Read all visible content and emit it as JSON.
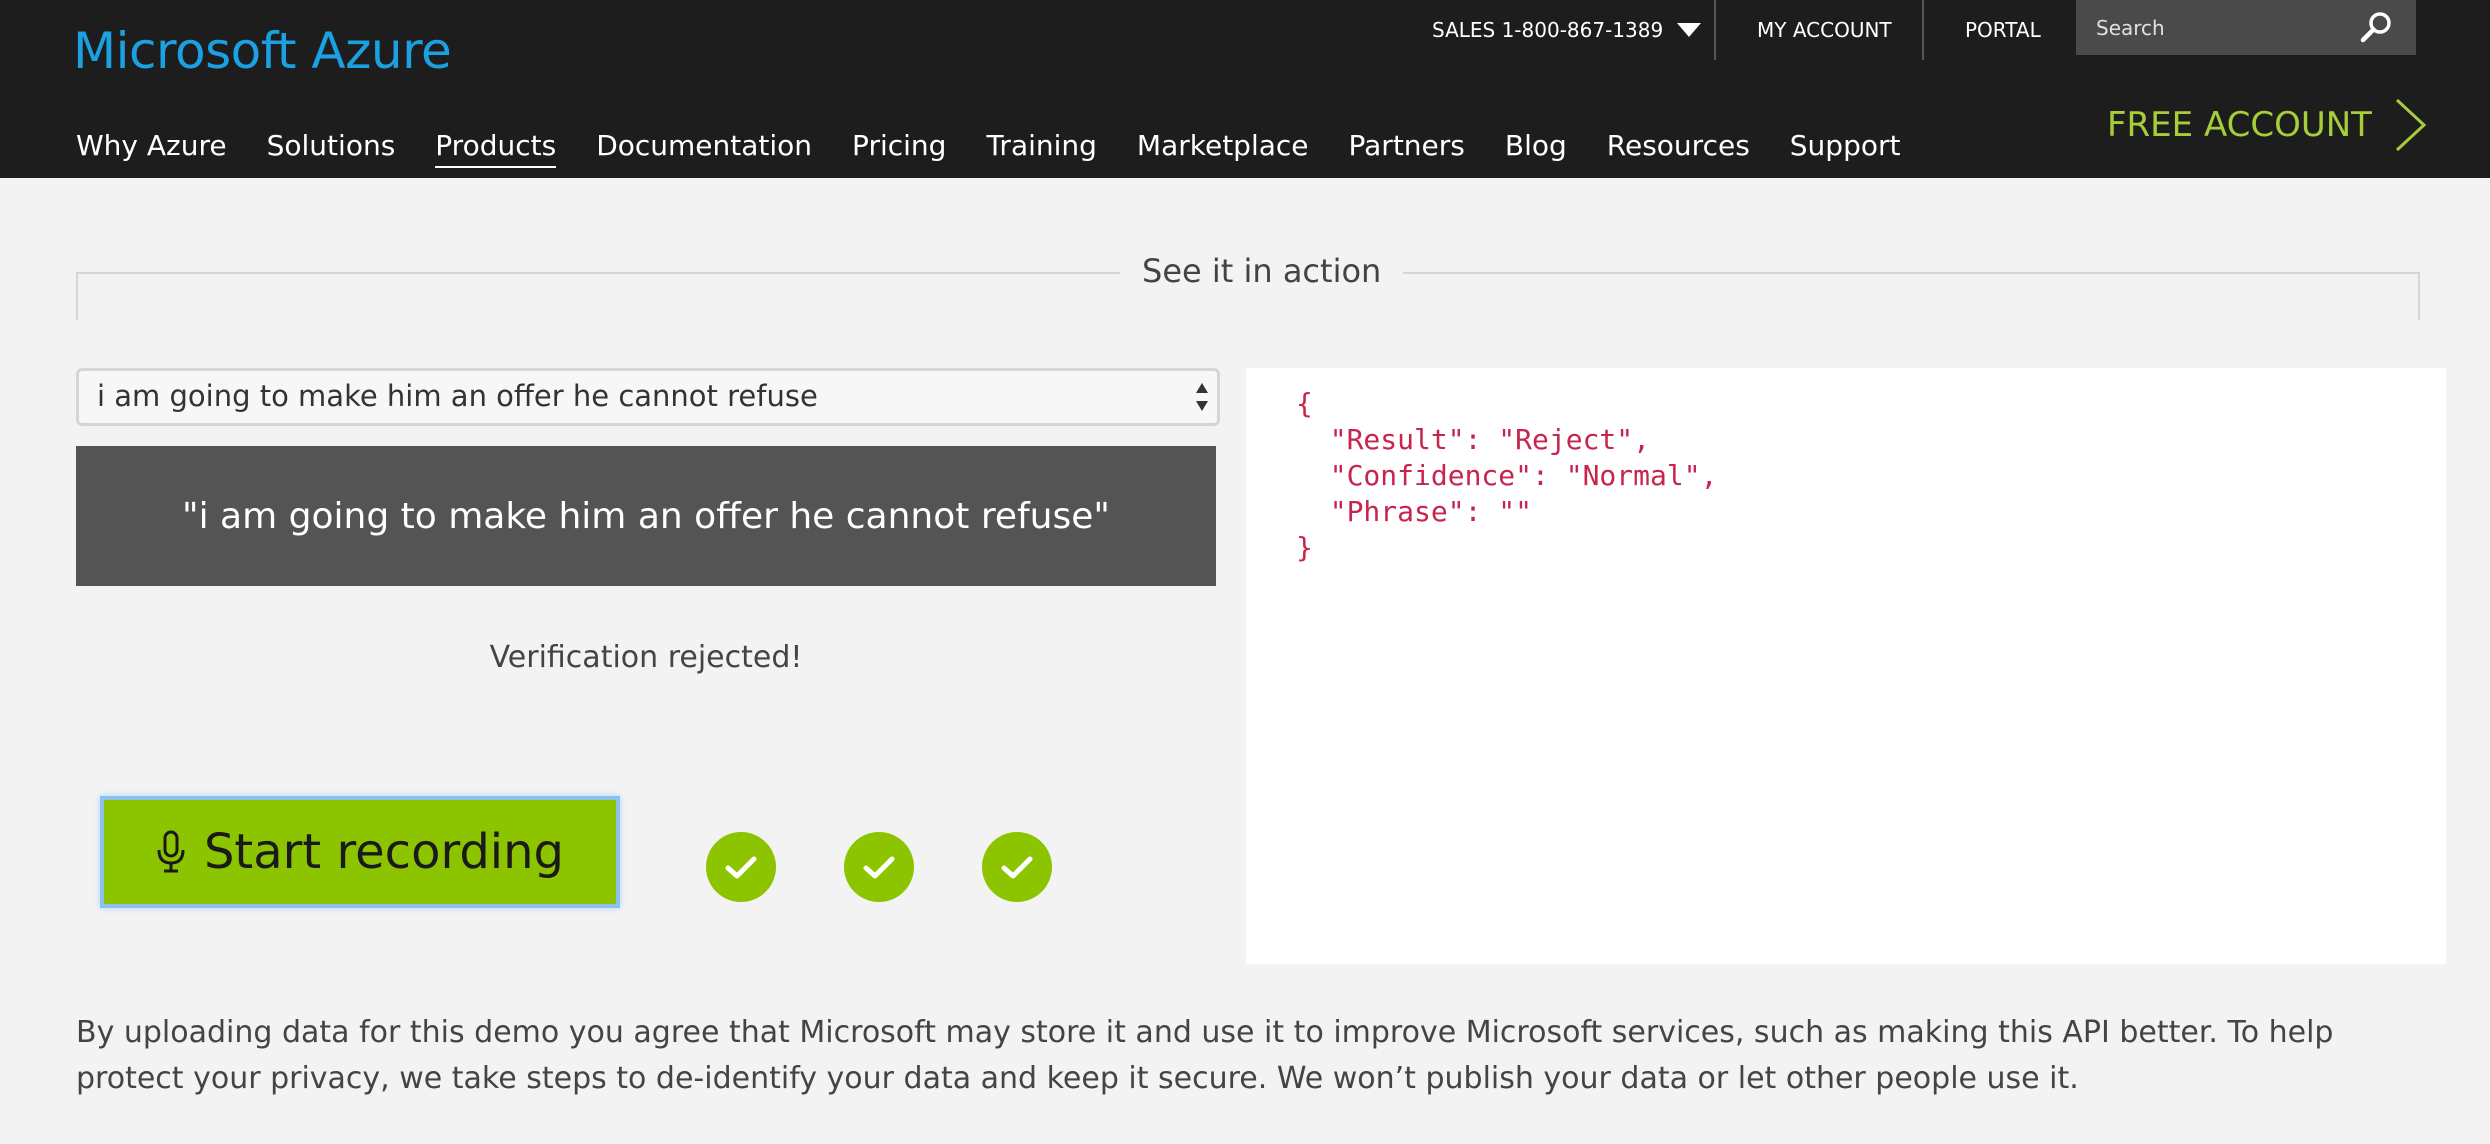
{
  "header": {
    "logo": "Microsoft Azure",
    "sales": "SALES 1-800-867-1389",
    "my_account": "MY ACCOUNT",
    "portal": "PORTAL",
    "search_placeholder": "Search",
    "nav": [
      "Why Azure",
      "Solutions",
      "Products",
      "Documentation",
      "Pricing",
      "Training",
      "Marketplace",
      "Partners",
      "Blog",
      "Resources",
      "Support"
    ],
    "active_nav": "Products",
    "free_account": "FREE ACCOUNT"
  },
  "section": {
    "title": "See it in action"
  },
  "demo": {
    "selected_phrase": "i am going to make him an offer he cannot refuse",
    "phrase_display": "\"i am going to make him an offer he cannot refuse\"",
    "status": "Verification rejected!",
    "record_button": "Start recording",
    "checks_completed": 3
  },
  "result": {
    "json_text": "{\n  \"Result\": \"Reject\",\n  \"Confidence\": \"Normal\",\n  \"Phrase\": \"\"\n}"
  },
  "disclaimer": "By uploading data for this demo you agree that Microsoft may store it and use it to improve Microsoft services, such as making this API better. To help protect your privacy, we take steps to de-identify your data and keep it secure. We won’t publish your data or let other people use it.",
  "colors": {
    "accent_green": "#8cc400",
    "free_account_green": "#a6ce39",
    "logo_blue": "#1ba1e2",
    "json_red": "#c7254e"
  }
}
